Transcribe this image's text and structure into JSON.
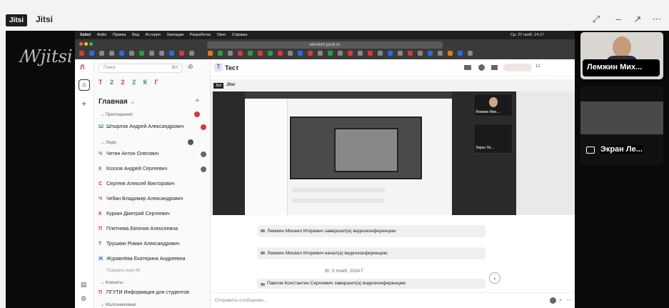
{
  "app": {
    "badge": "Jitsi",
    "title": "Jitsi"
  },
  "window_controls": {
    "expand": "⤢",
    "minimize": "–",
    "popout": "↗",
    "more": "⋯"
  },
  "stage": {
    "watermark": "jitsi"
  },
  "mac_menubar": {
    "items": [
      "",
      "Safari",
      "Файл",
      "Правка",
      "Вид",
      "История",
      "Закладки",
      "Разработка",
      "Окно",
      "Справка"
    ],
    "status": "Ср, 27 нояб. 14:17"
  },
  "browser": {
    "url": "element.psuti.ru"
  },
  "element": {
    "rail_letter": "Л",
    "search_placeholder": "Поиск",
    "search_shortcut": "⌘K",
    "space_chips": [
      "Т",
      "2",
      "2",
      "2",
      "К",
      "Г"
    ],
    "home_label": "Главная",
    "sections": {
      "invites": "Приглашения",
      "people": "Люди",
      "show_more": "Показать ещё 64",
      "rooms": "Комнаты",
      "low_priority": "Малозначимые"
    },
    "invites": [
      {
        "letter": "Ш",
        "name": "Штырлов Андрей Александрович"
      }
    ],
    "people": [
      {
        "letter": "Ч",
        "name": "Четин Антон Олегович"
      },
      {
        "letter": "К",
        "name": "Козлов Андрей Сергеевич"
      },
      {
        "letter": "С",
        "name": "Сергеев Алексей Викторович"
      },
      {
        "letter": "Ч",
        "name": "Чебан Владимир Александрович"
      },
      {
        "letter": "К",
        "name": "Куркин Дмитрий Сергеевич"
      },
      {
        "letter": "П",
        "name": "Плетнева Евгения Алексеевна"
      },
      {
        "letter": "Т",
        "name": "Трушкин Роман Александрович"
      },
      {
        "letter": "Ж",
        "name": "Журавлёва Екатерина Андреевна"
      }
    ],
    "rooms": [
      {
        "letter": "П",
        "name": "ПГУТИ Информация для студентов"
      }
    ],
    "room": {
      "avatar": "Т",
      "title": "Тест",
      "counter": "12"
    },
    "inner": {
      "badge": "Jitsi",
      "title": "Jitsi",
      "tile_name": "Лемжин Мих...",
      "screen_name": "Экран Ле..."
    },
    "messages": [
      "Лемжин Михаил Игоревич завершил(а) видеоконференцию",
      "Лемжин Михаил Игоревич начал(а) видеоконференцию",
      "Павлов Константин Сергеевич завершил(а) видеоконференцию"
    ],
    "date_separator": "Вт, 5 Нояб. 2024 Г.",
    "composer_placeholder": "Отправить сообщение...",
    "scroll_down": "⌄"
  },
  "participants": [
    {
      "name": "Лемжин Мих..."
    },
    {
      "name": "Экран Ле..."
    }
  ],
  "colors": {
    "red": "#d9383a",
    "green": "#2e9b46",
    "blue": "#2a6fd6",
    "orange": "#e07a1f",
    "purple": "#7a4ab5"
  }
}
